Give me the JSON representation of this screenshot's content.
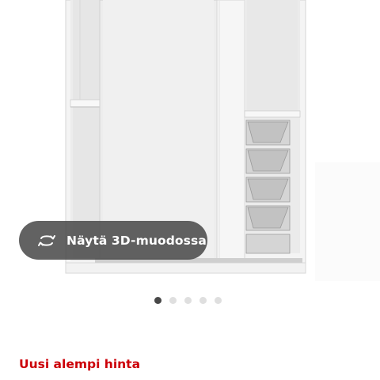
{
  "gallery": {
    "image_alt": "",
    "view_3d": {
      "label": "Näytä 3D-muodossa",
      "icon": "rotate-3d-icon"
    },
    "pagination": {
      "total": 5,
      "active_index": 0
    }
  },
  "product": {
    "price_badge": "Uusi alempi hinta"
  },
  "colors": {
    "badge_red": "#cc0008",
    "overlay": "#484848",
    "dot_inactive": "#dfdfdf",
    "dot_active": "#484848"
  }
}
